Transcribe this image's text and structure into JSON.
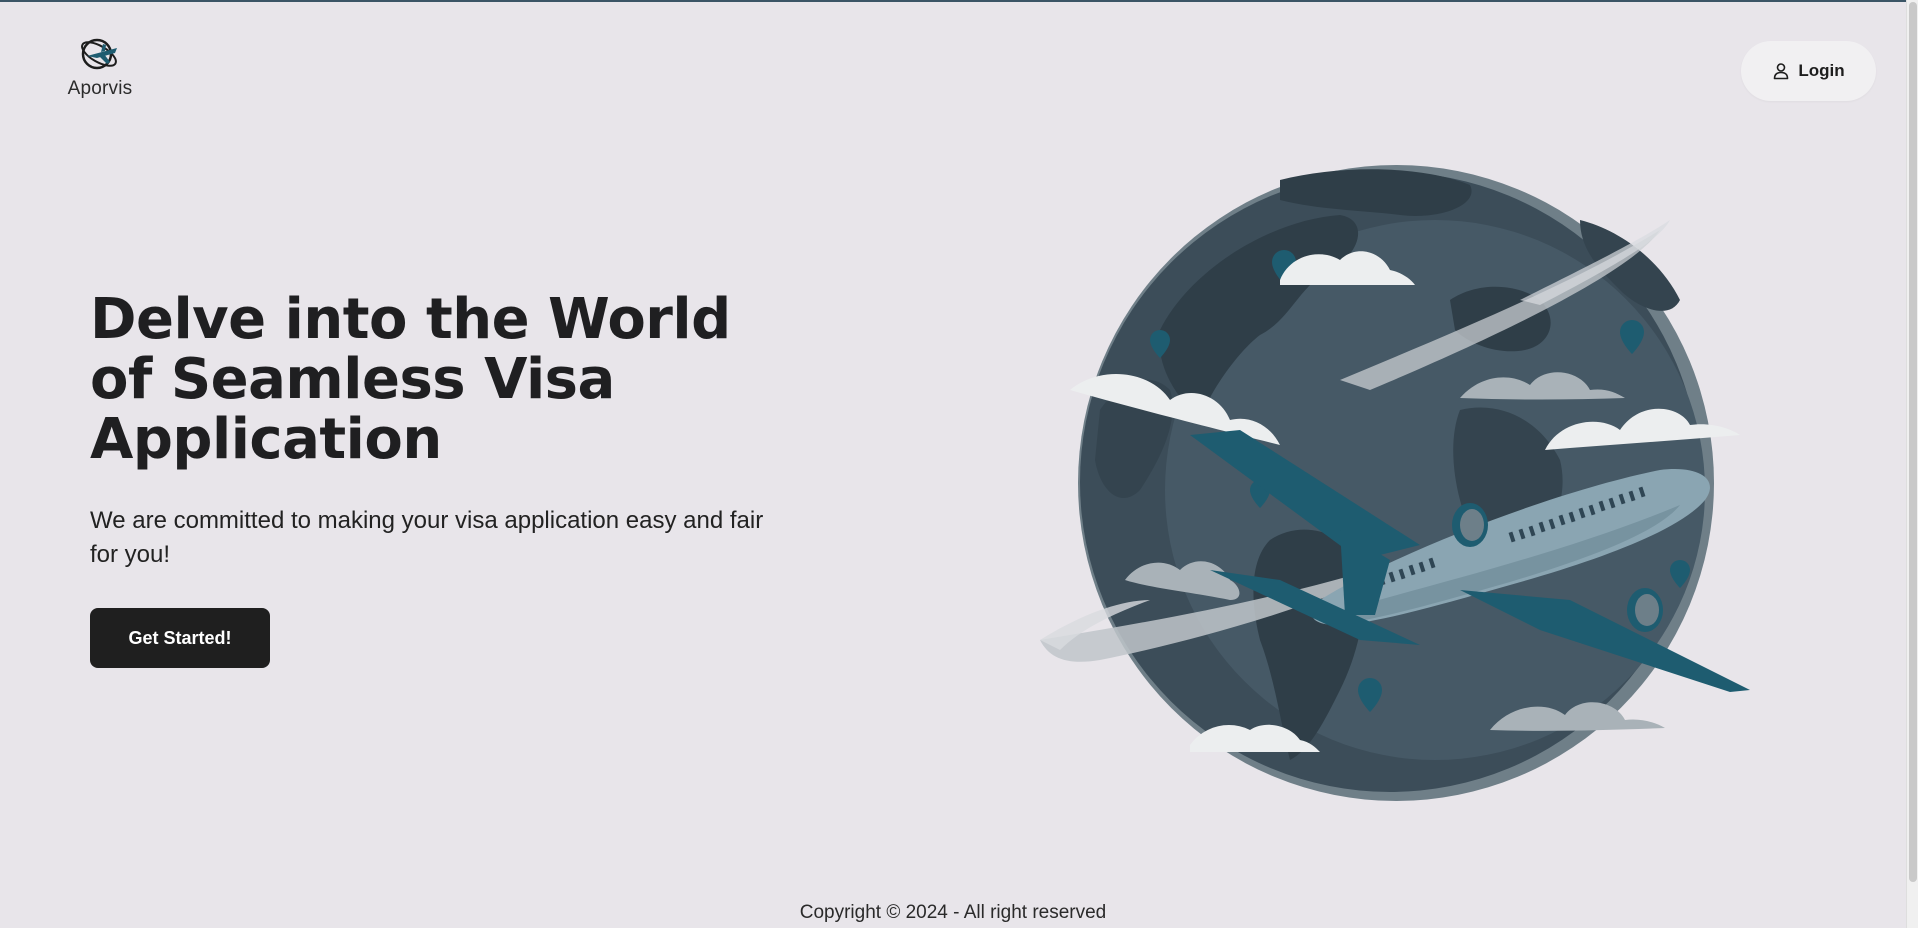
{
  "brand": {
    "name": "Aporvis",
    "logo_icon": "globe-plane-icon"
  },
  "header": {
    "login_label": "Login",
    "login_icon": "user-icon"
  },
  "hero": {
    "title": "Delve into the World of Seamless Visa Application",
    "subtitle": "We are committed to making your visa application easy and fair for you!",
    "cta_label": "Get Started!"
  },
  "illustration": {
    "icon": "globe-airplane-illustration"
  },
  "footer": {
    "copyright": "Copyright © 2024 - All right reserved"
  },
  "colors": {
    "background": "#e8e5ea",
    "globe_dark": "#3d4f5b",
    "accent_teal": "#1e5c70",
    "plane_body": "#8aa5b2",
    "button_dark": "#1f1f1f"
  }
}
